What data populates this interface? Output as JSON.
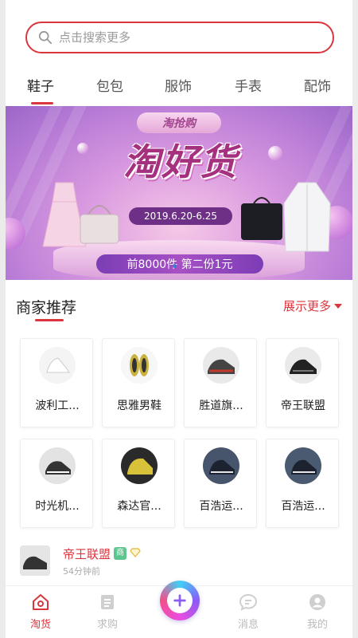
{
  "search": {
    "placeholder": "点击搜索更多"
  },
  "tabs": [
    {
      "label": "鞋子",
      "active": true
    },
    {
      "label": "包包",
      "active": false
    },
    {
      "label": "服饰",
      "active": false
    },
    {
      "label": "手表",
      "active": false
    },
    {
      "label": "配饰",
      "active": false
    }
  ],
  "banner": {
    "badge": "淘抢购",
    "headline": "淘好货",
    "date": "2019.6.20-6.25",
    "promo": "前8000件 第二份1元"
  },
  "section": {
    "title": "商家推荐",
    "more": "展示更多"
  },
  "shops": [
    {
      "name": "波利工..."
    },
    {
      "name": "思雅男鞋"
    },
    {
      "name": "胜道旗..."
    },
    {
      "name": "帝王联盟"
    },
    {
      "name": "时光机..."
    },
    {
      "name": "森达官..."
    },
    {
      "name": "百浩运..."
    },
    {
      "name": "百浩运..."
    }
  ],
  "feed": {
    "name": "帝王联盟",
    "tag": "商",
    "time": "54分钟前"
  },
  "nav": [
    {
      "label": "淘货",
      "icon": "home-icon",
      "active": true
    },
    {
      "label": "求购",
      "icon": "list-icon",
      "active": false
    },
    {
      "label": "消息",
      "icon": "message-icon",
      "active": false
    },
    {
      "label": "我的",
      "icon": "profile-icon",
      "active": false
    }
  ],
  "colors": {
    "accent": "#d9363e",
    "tag_green": "#5fc58e"
  }
}
